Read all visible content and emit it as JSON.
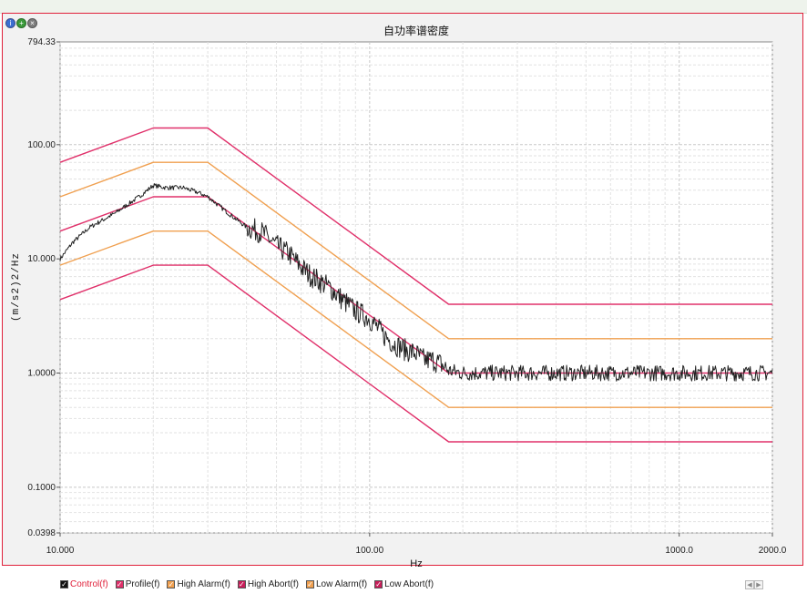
{
  "window_controls": [
    "info-icon",
    "add-icon",
    "close-icon"
  ],
  "legend": [
    {
      "label": "Control(f)",
      "color": "#111111",
      "text_color": "#e0203a",
      "checked": true
    },
    {
      "label": "Profile(f)",
      "color": "#e0306a",
      "text_color": "#222222",
      "checked": true
    },
    {
      "label": "High Alarm(f)",
      "color": "#f0a050",
      "text_color": "#222222",
      "checked": true
    },
    {
      "label": "High Abort(f)",
      "color": "#c81e5a",
      "text_color": "#222222",
      "checked": true
    },
    {
      "label": "Low Alarm(f)",
      "color": "#f0a050",
      "text_color": "#222222",
      "checked": true
    },
    {
      "label": "Low Abort(f)",
      "color": "#c81e5a",
      "text_color": "#222222",
      "checked": true
    }
  ],
  "chart_data": {
    "type": "line",
    "title": "自功率谱密度",
    "xlabel": "Hz",
    "ylabel": "(m/s2)2/Hz",
    "x_scale": "log",
    "y_scale": "log",
    "xlim": [
      10,
      2000
    ],
    "ylim": [
      0.0398,
      794.33
    ],
    "x_tick_labels": [
      {
        "value": 10,
        "label": "10.000"
      },
      {
        "value": 100,
        "label": "100.00"
      },
      {
        "value": 1000,
        "label": "1000.0"
      },
      {
        "value": 2000,
        "label": "2000.0"
      }
    ],
    "y_tick_labels": [
      {
        "value": 794.33,
        "label": "794.33"
      },
      {
        "value": 100,
        "label": "100.00"
      },
      {
        "value": 10,
        "label": "10.000"
      },
      {
        "value": 1,
        "label": "1.0000"
      },
      {
        "value": 0.1,
        "label": "0.1000"
      },
      {
        "value": 0.0398,
        "label": "0.0398"
      }
    ],
    "grid": true,
    "background": "#ffffff",
    "series": [
      {
        "name": "High Abort(f)",
        "color": "#e0306a",
        "x": [
          10,
          20,
          30,
          180,
          2000
        ],
        "y": [
          70,
          140,
          140,
          4,
          4
        ]
      },
      {
        "name": "High Alarm(f)",
        "color": "#f0a050",
        "x": [
          10,
          20,
          30,
          180,
          2000
        ],
        "y": [
          35,
          70,
          70,
          2,
          2
        ]
      },
      {
        "name": "Profile(f)",
        "color": "#e0306a",
        "x": [
          10,
          20,
          30,
          180,
          2000
        ],
        "y": [
          17.5,
          35,
          35,
          1,
          1
        ]
      },
      {
        "name": "Low Alarm(f)",
        "color": "#f0a050",
        "x": [
          10,
          20,
          30,
          180,
          2000
        ],
        "y": [
          8.8,
          17.5,
          17.5,
          0.5,
          0.5
        ]
      },
      {
        "name": "Low Abort(f)",
        "color": "#e0306a",
        "x": [
          10,
          20,
          30,
          180,
          2000
        ],
        "y": [
          4.4,
          8.8,
          8.8,
          0.25,
          0.25
        ]
      },
      {
        "name": "Control(f)",
        "color": "#222222",
        "noisy": true,
        "x": [
          10,
          11,
          12.5,
          15,
          18,
          20,
          22,
          25,
          28,
          30,
          35,
          40,
          45,
          50,
          55,
          60,
          65,
          70,
          75,
          80,
          90,
          100,
          110,
          120,
          130,
          140,
          150,
          160,
          170,
          180,
          200,
          250,
          300,
          400,
          500,
          600,
          800,
          1000,
          1200,
          1500,
          1800,
          2000
        ],
        "y": [
          10,
          14,
          19,
          25,
          35,
          44,
          42,
          42,
          38,
          35,
          25,
          19,
          17,
          13,
          11,
          8.5,
          7,
          6.2,
          5.5,
          4.6,
          3.5,
          3.0,
          2.2,
          1.8,
          1.6,
          1.5,
          1.3,
          1.3,
          1.2,
          1.05,
          1.0,
          1.0,
          1.0,
          1.0,
          1.0,
          1.0,
          1.0,
          1.0,
          1.0,
          1.0,
          1.0,
          1.0
        ]
      }
    ]
  }
}
